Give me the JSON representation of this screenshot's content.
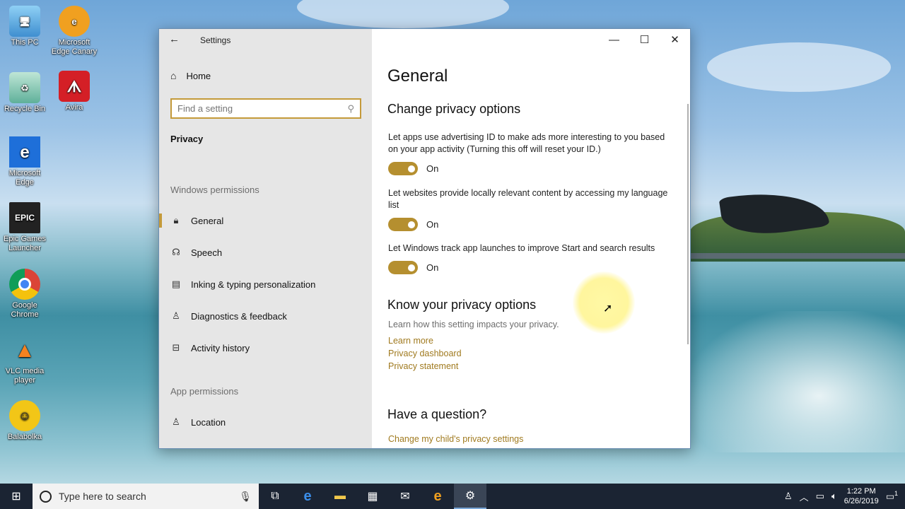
{
  "desktop": {
    "icons": [
      {
        "label": "This PC"
      },
      {
        "label": "Microsoft Edge Canary"
      },
      {
        "label": "Recycle Bin"
      },
      {
        "label": "Avira"
      },
      {
        "label": "Microsoft Edge"
      },
      {
        "label": "Epic Games Launcher"
      },
      {
        "label": "Google Chrome"
      },
      {
        "label": "VLC media player"
      },
      {
        "label": "Balabolka"
      }
    ]
  },
  "window": {
    "title": "Settings",
    "minimize_glyph": "—",
    "maximize_glyph": "☐",
    "close_glyph": "✕"
  },
  "sidebar": {
    "home_label": "Home",
    "search_placeholder": "Find a setting",
    "category": "Privacy",
    "windows_permissions_title": "Windows permissions",
    "windows_items": [
      {
        "label": "General",
        "icon": "lock-icon",
        "active": true
      },
      {
        "label": "Speech",
        "icon": "speech-icon"
      },
      {
        "label": "Inking & typing personalization",
        "icon": "clipboard-icon"
      },
      {
        "label": "Diagnostics & feedback",
        "icon": "people-feedback-icon"
      },
      {
        "label": "Activity history",
        "icon": "activity-icon"
      }
    ],
    "app_permissions_title": "App permissions",
    "app_items": [
      {
        "label": "Location",
        "icon": "location-icon"
      }
    ]
  },
  "content": {
    "title": "General",
    "section1_title": "Change privacy options",
    "options": [
      {
        "description": "Let apps use advertising ID to make ads more interesting to you based on your app activity (Turning this off will reset your ID.)",
        "state": "On"
      },
      {
        "description": "Let websites provide locally relevant content by accessing my language list",
        "state": "On"
      },
      {
        "description": "Let Windows track app launches to improve Start and search results",
        "state": "On"
      }
    ],
    "section2_title": "Know your privacy options",
    "section2_desc": "Learn how this setting impacts your privacy.",
    "links": [
      "Learn more",
      "Privacy dashboard",
      "Privacy statement"
    ],
    "section3_title": "Have a question?",
    "section3_link": "Change my child's privacy settings"
  },
  "taskbar": {
    "search_placeholder": "Type here to search",
    "time": "1:22 PM",
    "date": "6/26/2019",
    "notification_count": "1"
  },
  "colors": {
    "accent": "#b58f2f",
    "link": "#a07a1f",
    "taskbar": "#1b2433"
  }
}
